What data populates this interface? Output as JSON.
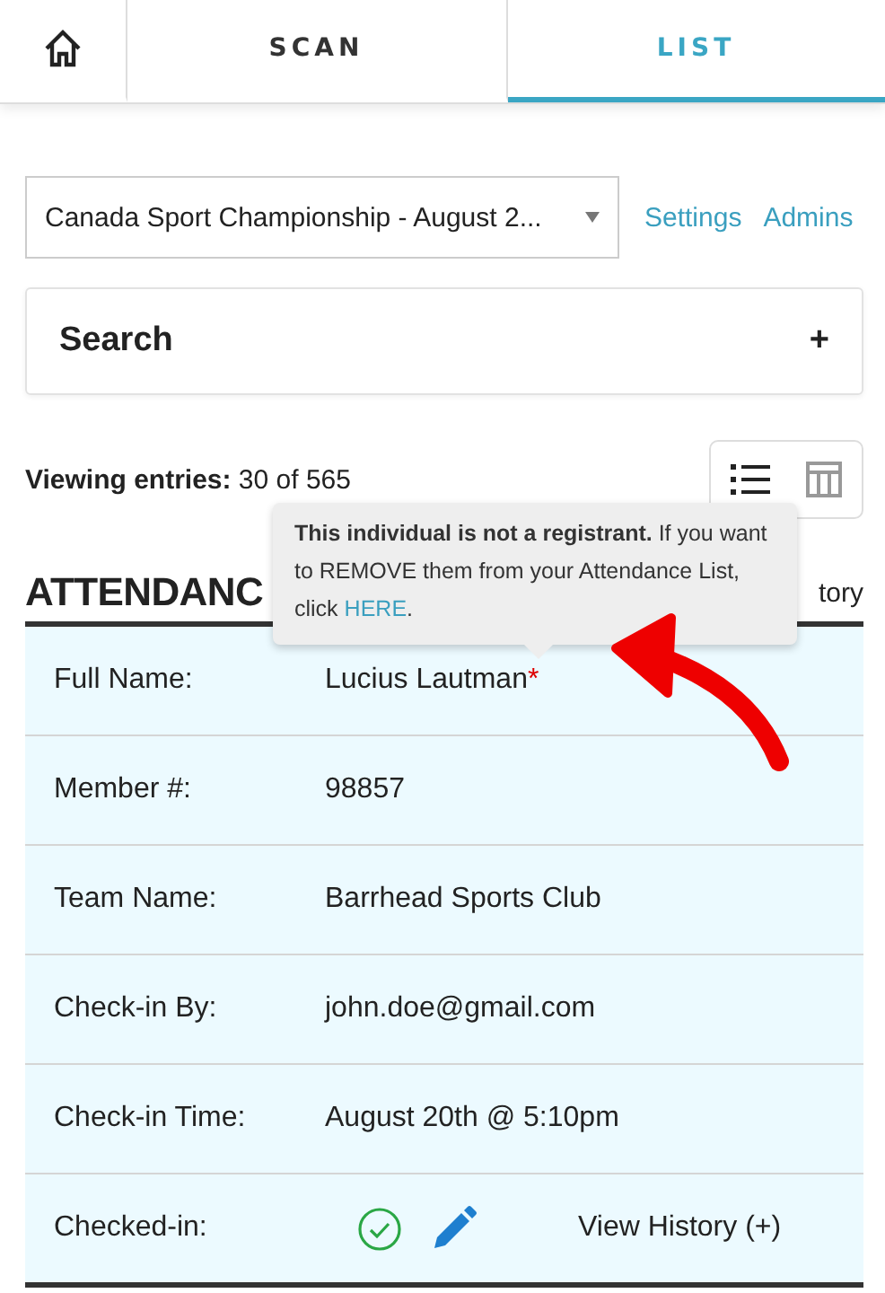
{
  "tabs": [
    {
      "kind": "home",
      "selected": false
    },
    {
      "kind": "text",
      "label": "SCAN",
      "selected": false
    },
    {
      "kind": "text",
      "label": "LIST",
      "selected": true
    }
  ],
  "event_select": {
    "value": "Canada Sport Championship - August 2..."
  },
  "links": [
    "Settings",
    "Admins"
  ],
  "search_panel": {
    "title": "Search",
    "toggle": "+"
  },
  "viewing": {
    "label": "Viewing entries:",
    "value": "30 of 565"
  },
  "view_modes": [
    {
      "kind": "list",
      "selected": true
    },
    {
      "kind": "table",
      "selected": false
    }
  ],
  "section": {
    "heading": "ATTENDANC",
    "side_link": "tory"
  },
  "tooltip": {
    "text": "**This individual is not a registrant.** If you want to REMOVE them from your Attendance List, click",
    "link": "HERE",
    "end": "."
  },
  "rows": [
    {
      "kind": "text",
      "label": "Full Name:",
      "value": "Lucius Lautman",
      "mark": "*"
    },
    {
      "kind": "text",
      "label": "Member #:",
      "value": "98857"
    },
    {
      "kind": "text",
      "label": "Team Name:",
      "value": "Barrhead Sports Club"
    },
    {
      "kind": "text",
      "label": "Check-in By:",
      "value": "john.doe@gmail.com"
    },
    {
      "kind": "text",
      "label": "Check-in Time:",
      "value": "August 20th @ 5:10pm"
    },
    {
      "kind": "status",
      "label": "Checked-in:",
      "checked": true,
      "link": "View History (+)"
    }
  ]
}
